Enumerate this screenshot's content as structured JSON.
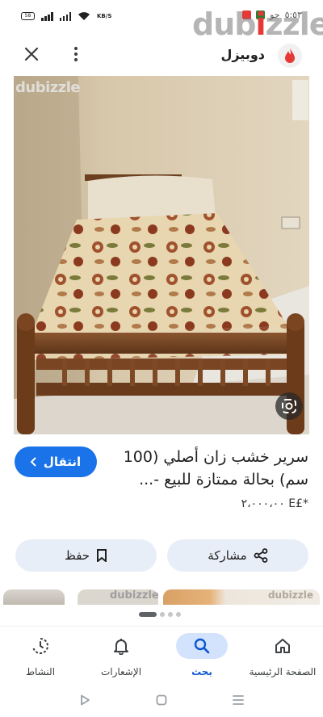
{
  "status_bar": {
    "battery": "58",
    "speed_top": "KB/S",
    "time": "٥:٥٣",
    "carrier": "جو"
  },
  "watermark": {
    "text": "dub",
    "accent": "i",
    "rest": "zzle"
  },
  "app_bar": {
    "site_name": "دوبيزل",
    "close_icon": "close-icon",
    "menu_icon": "more-vert-icon"
  },
  "image": {
    "watermark": "dubizzle",
    "lens_icon": "google-lens-icon"
  },
  "listing": {
    "title": "سرير خشب زان أصلي (100 سم) بحالة ممتازة للبيع -...",
    "price": "*£E ٢،٠٠٠،٠٠",
    "visit_label": "انتقال"
  },
  "actions": {
    "save_label": "حفظ",
    "share_label": "مشاركة"
  },
  "related": {
    "thumb_wm_2": "dubizzle",
    "thumb_wm_3": "dubizzle"
  },
  "bottom_nav": {
    "items": [
      {
        "label": "الصفحة الرئيسية",
        "icon": "home-icon"
      },
      {
        "label": "بحث",
        "icon": "search-icon"
      },
      {
        "label": "الإشعارات",
        "icon": "bell-icon"
      },
      {
        "label": "النشاط",
        "icon": "activity-icon"
      }
    ],
    "active_index": 1
  },
  "colors": {
    "accent": "#1a73e8",
    "chip": "#e8eef8",
    "nav_active": "#d3e3fd",
    "brand_red": "#e53935"
  }
}
